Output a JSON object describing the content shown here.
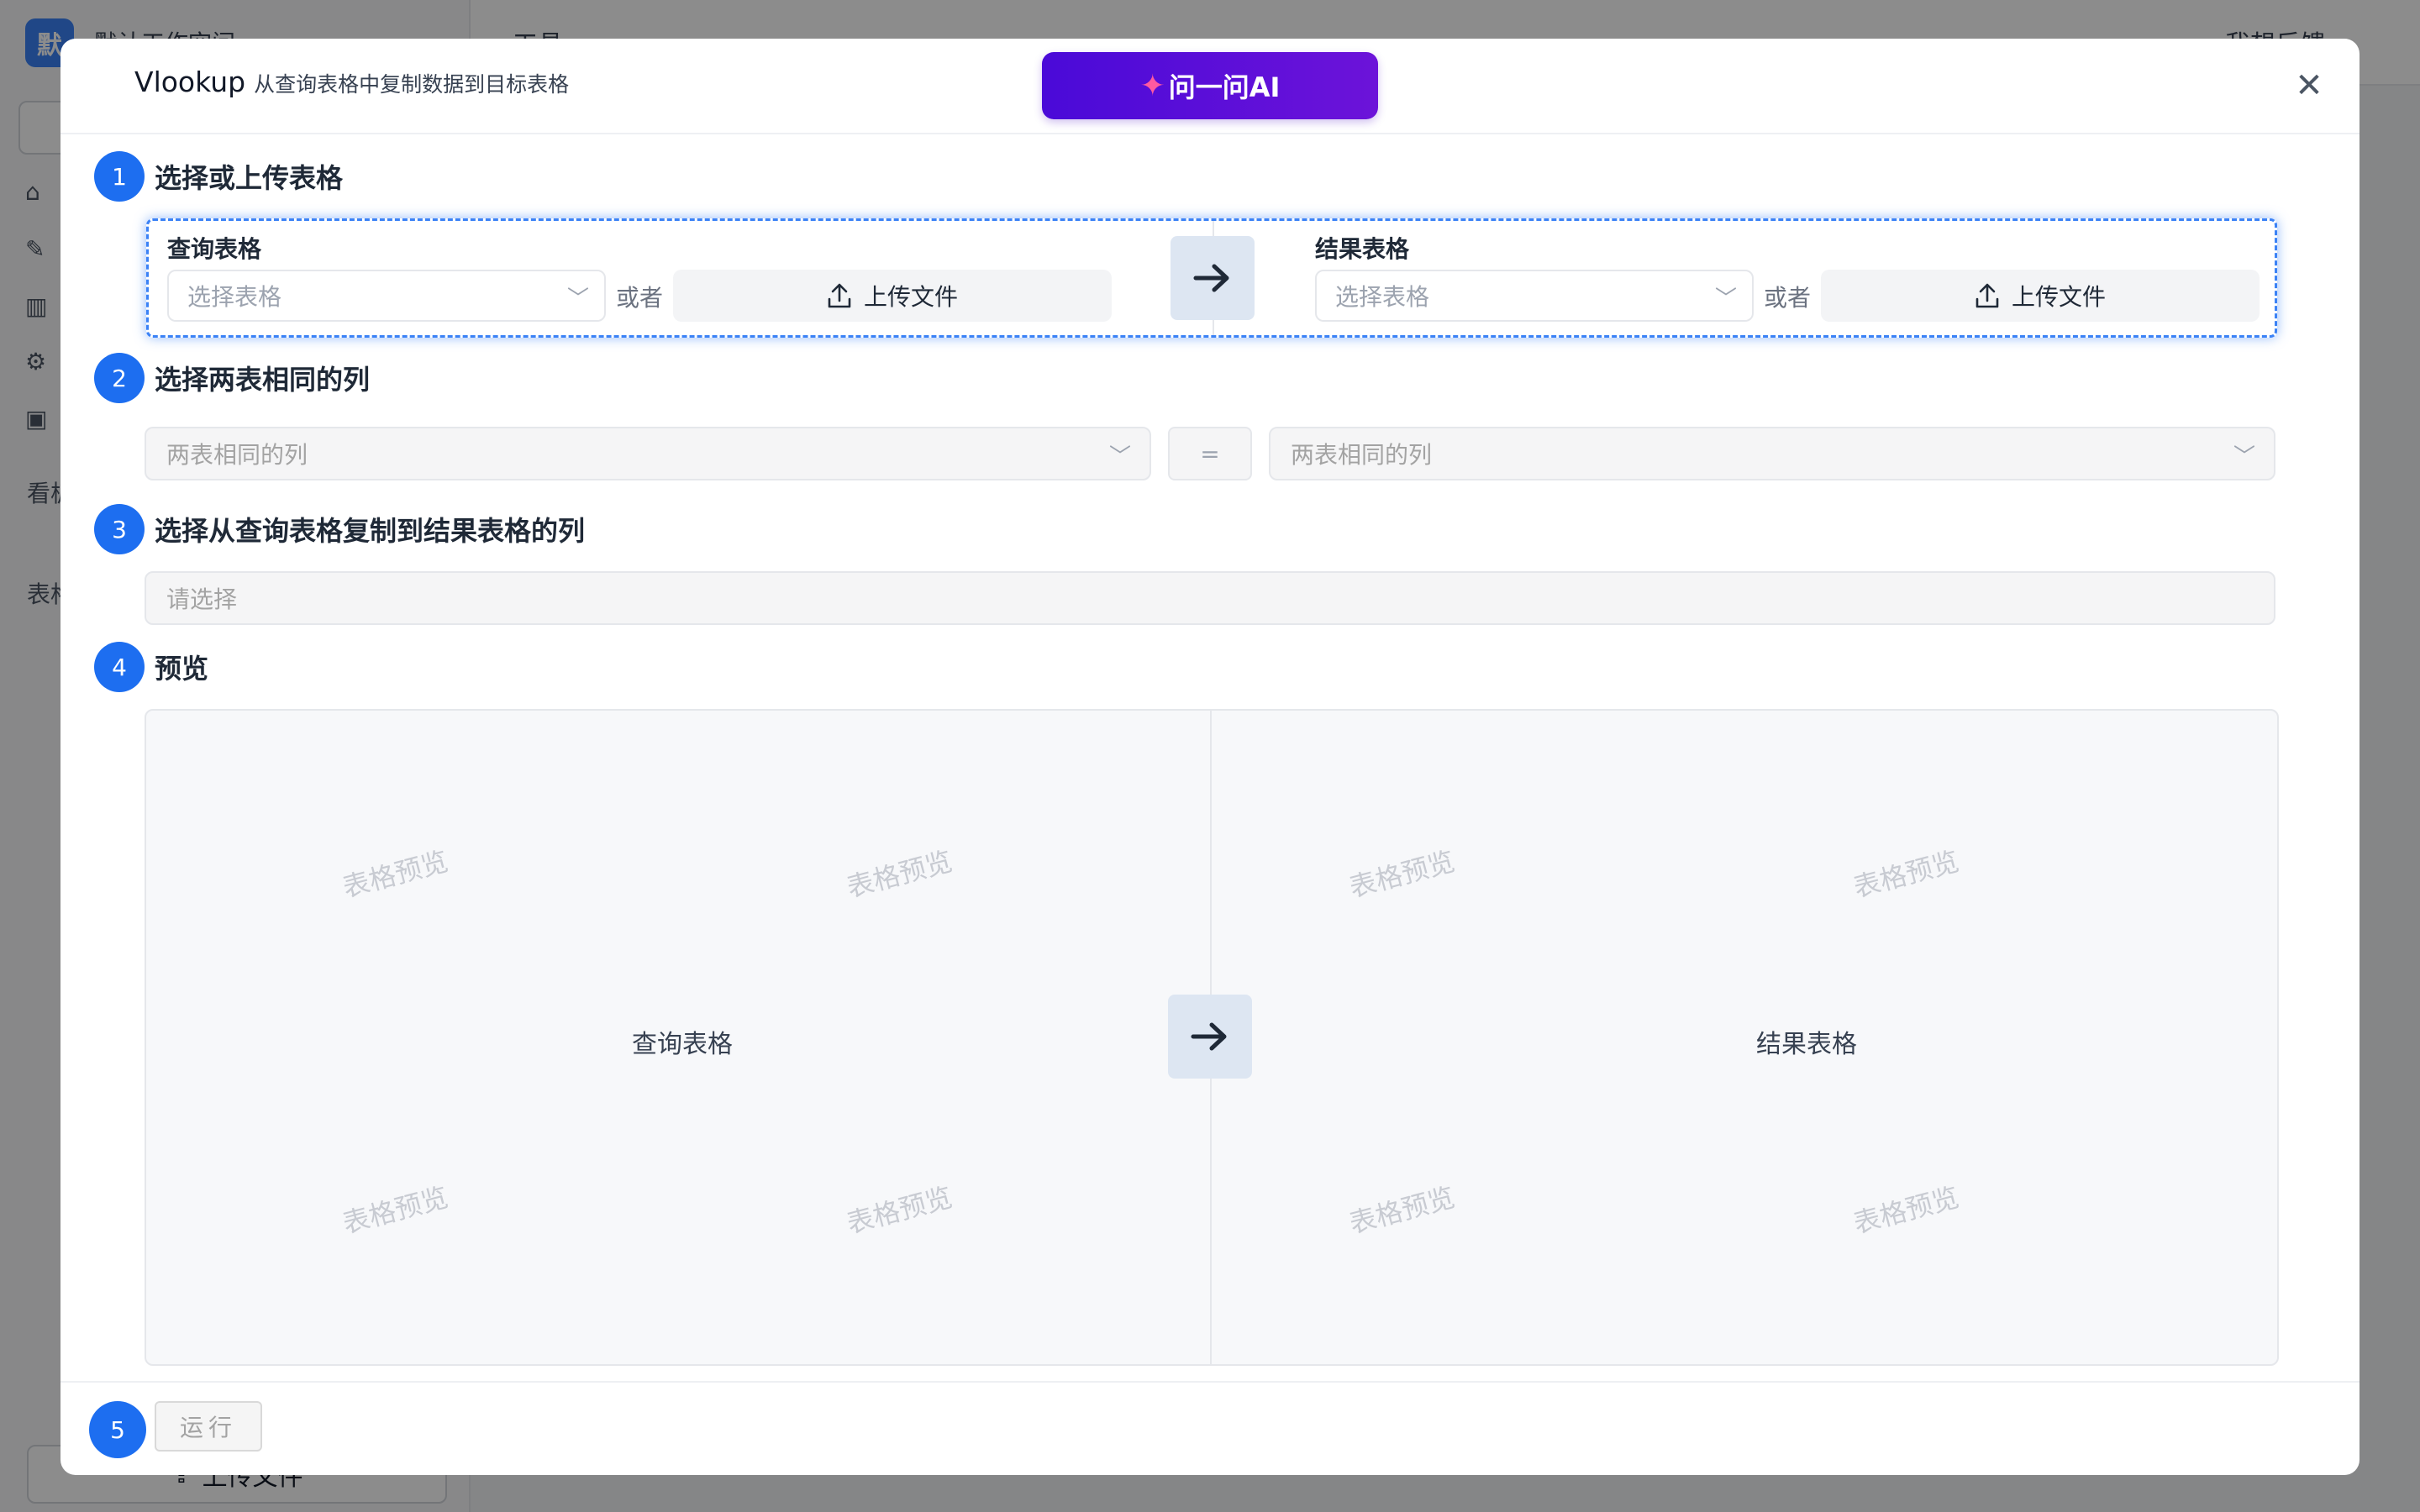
{
  "background": {
    "workspace_logo": "默",
    "workspace_name": "默认工作空间",
    "section_board": "看板",
    "section_table": "表格",
    "top_tool": "工具",
    "top_feedback": "我想反馈",
    "bottom_upload": "上传文件"
  },
  "modal": {
    "title": "Vlookup",
    "subtitle": "从查询表格中复制数据到目标表格",
    "ai_button": "问一问AI",
    "step1": {
      "num": "1",
      "label": "选择或上传表格",
      "query_label": "查询表格",
      "query_placeholder": "选择表格",
      "or": "或者",
      "upload": "上传文件",
      "result_label": "结果表格",
      "result_placeholder": "选择表格",
      "or2": "或者",
      "upload2": "上传文件"
    },
    "step2": {
      "num": "2",
      "label": "选择两表相同的列",
      "left_placeholder": "两表相同的列",
      "equals": "=",
      "right_placeholder": "两表相同的列"
    },
    "step3": {
      "num": "3",
      "label": "选择从查询表格复制到结果表格的列",
      "placeholder": "请选择"
    },
    "step4": {
      "num": "4",
      "label": "预览",
      "watermark": "表格预览",
      "left_label": "查询表格",
      "right_label": "结果表格"
    },
    "step5": {
      "num": "5",
      "run": "运行"
    }
  },
  "colors": {
    "accent": "#1d6ef0",
    "ai_gradient_start": "#4a0ad8",
    "ai_gradient_end": "#6c13d9"
  }
}
